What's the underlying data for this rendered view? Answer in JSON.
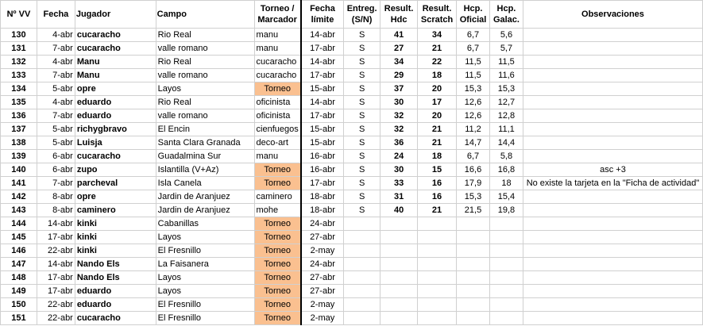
{
  "highlight_color": "#fac090",
  "headers": {
    "nvv": "Nº VV",
    "fecha": "Fecha",
    "jugador": "Jugador",
    "campo": "Campo",
    "torneo": "Torneo / Marcador",
    "limite": "Fecha límite",
    "entreg": "Entreg. (S/N)",
    "hdc": "Result. Hdc",
    "scratch": "Result. Scratch",
    "hcp_oficial": "Hcp. Oficial",
    "hcp_galac": "Hcp. Galac.",
    "observaciones": "Observaciones"
  },
  "rows": [
    {
      "n": "130",
      "fecha": "4-abr",
      "jugador": "cucaracho",
      "campo": "Rio Real",
      "marcador": "manu",
      "torneo": false,
      "limite": "14-abr",
      "entreg": "S",
      "hdc": "41",
      "scratch": "34",
      "oficial": "6,7",
      "galac": "5,6",
      "obs": ""
    },
    {
      "n": "131",
      "fecha": "7-abr",
      "jugador": "cucaracho",
      "campo": "valle romano",
      "marcador": "manu",
      "torneo": false,
      "limite": "17-abr",
      "entreg": "S",
      "hdc": "27",
      "scratch": "21",
      "oficial": "6,7",
      "galac": "5,7",
      "obs": ""
    },
    {
      "n": "132",
      "fecha": "4-abr",
      "jugador": "Manu",
      "campo": "Rio Real",
      "marcador": "cucaracho",
      "torneo": false,
      "limite": "14-abr",
      "entreg": "S",
      "hdc": "34",
      "scratch": "22",
      "oficial": "11,5",
      "galac": "11,5",
      "obs": ""
    },
    {
      "n": "133",
      "fecha": "7-abr",
      "jugador": "Manu",
      "campo": "valle romano",
      "marcador": "cucaracho",
      "torneo": false,
      "limite": "17-abr",
      "entreg": "S",
      "hdc": "29",
      "scratch": "18",
      "oficial": "11,5",
      "galac": "11,6",
      "obs": ""
    },
    {
      "n": "134",
      "fecha": "5-abr",
      "jugador": "opre",
      "campo": "Layos",
      "marcador": "Torneo",
      "torneo": true,
      "limite": "15-abr",
      "entreg": "S",
      "hdc": "37",
      "scratch": "20",
      "oficial": "15,3",
      "galac": "15,3",
      "obs": ""
    },
    {
      "n": "135",
      "fecha": "4-abr",
      "jugador": "eduardo",
      "campo": "Rio Real",
      "marcador": "oficinista",
      "torneo": false,
      "limite": "14-abr",
      "entreg": "S",
      "hdc": "30",
      "scratch": "17",
      "oficial": "12,6",
      "galac": "12,7",
      "obs": ""
    },
    {
      "n": "136",
      "fecha": "7-abr",
      "jugador": "eduardo",
      "campo": "valle romano",
      "marcador": "oficinista",
      "torneo": false,
      "limite": "17-abr",
      "entreg": "S",
      "hdc": "32",
      "scratch": "20",
      "oficial": "12,6",
      "galac": "12,8",
      "obs": ""
    },
    {
      "n": "137",
      "fecha": "5-abr",
      "jugador": "richygbravo",
      "campo": "El Encin",
      "marcador": "cienfuegos",
      "torneo": false,
      "limite": "15-abr",
      "entreg": "S",
      "hdc": "32",
      "scratch": "21",
      "oficial": "11,2",
      "galac": "11,1",
      "obs": ""
    },
    {
      "n": "138",
      "fecha": "5-abr",
      "jugador": "Luisja",
      "campo": "Santa Clara Granada",
      "marcador": "deco-art",
      "torneo": false,
      "limite": "15-abr",
      "entreg": "S",
      "hdc": "36",
      "scratch": "21",
      "oficial": "14,7",
      "galac": "14,4",
      "obs": ""
    },
    {
      "n": "139",
      "fecha": "6-abr",
      "jugador": "cucaracho",
      "campo": "Guadalmina Sur",
      "marcador": "manu",
      "torneo": false,
      "limite": "16-abr",
      "entreg": "S",
      "hdc": "24",
      "scratch": "18",
      "oficial": "6,7",
      "galac": "5,8",
      "obs": ""
    },
    {
      "n": "140",
      "fecha": "6-abr",
      "jugador": "zupo",
      "campo": "Islantilla (V+Az)",
      "marcador": "Torneo",
      "torneo": true,
      "limite": "16-abr",
      "entreg": "S",
      "hdc": "30",
      "scratch": "15",
      "oficial": "16,6",
      "galac": "16,8",
      "obs": "asc +3"
    },
    {
      "n": "141",
      "fecha": "7-abr",
      "jugador": "parcheval",
      "campo": "Isla Canela",
      "marcador": "Torneo",
      "torneo": true,
      "limite": "17-abr",
      "entreg": "S",
      "hdc": "33",
      "scratch": "16",
      "oficial": "17,9",
      "galac": "18",
      "obs": "No existe la tarjeta en la \"Ficha de actividad\""
    },
    {
      "n": "142",
      "fecha": "8-abr",
      "jugador": "opre",
      "campo": "Jardin de Aranjuez",
      "marcador": "caminero",
      "torneo": false,
      "limite": "18-abr",
      "entreg": "S",
      "hdc": "31",
      "scratch": "16",
      "oficial": "15,3",
      "galac": "15,4",
      "obs": ""
    },
    {
      "n": "143",
      "fecha": "8-abr",
      "jugador": "caminero",
      "campo": "Jardin de Aranjuez",
      "marcador": "mohe",
      "torneo": false,
      "limite": "18-abr",
      "entreg": "S",
      "hdc": "40",
      "scratch": "21",
      "oficial": "21,5",
      "galac": "19,8",
      "obs": ""
    },
    {
      "n": "144",
      "fecha": "14-abr",
      "jugador": "kinki",
      "campo": "Cabanillas",
      "marcador": "Torneo",
      "torneo": true,
      "limite": "24-abr",
      "entreg": "",
      "hdc": "",
      "scratch": "",
      "oficial": "",
      "galac": "",
      "obs": ""
    },
    {
      "n": "145",
      "fecha": "17-abr",
      "jugador": "kinki",
      "campo": "Layos",
      "marcador": "Torneo",
      "torneo": true,
      "limite": "27-abr",
      "entreg": "",
      "hdc": "",
      "scratch": "",
      "oficial": "",
      "galac": "",
      "obs": ""
    },
    {
      "n": "146",
      "fecha": "22-abr",
      "jugador": "kinki",
      "campo": "El Fresnillo",
      "marcador": "Torneo",
      "torneo": true,
      "limite": "2-may",
      "entreg": "",
      "hdc": "",
      "scratch": "",
      "oficial": "",
      "galac": "",
      "obs": ""
    },
    {
      "n": "147",
      "fecha": "14-abr",
      "jugador": "Nando Els",
      "campo": "La Faisanera",
      "marcador": "Torneo",
      "torneo": true,
      "limite": "24-abr",
      "entreg": "",
      "hdc": "",
      "scratch": "",
      "oficial": "",
      "galac": "",
      "obs": ""
    },
    {
      "n": "148",
      "fecha": "17-abr",
      "jugador": "Nando Els",
      "campo": "Layos",
      "marcador": "Torneo",
      "torneo": true,
      "limite": "27-abr",
      "entreg": "",
      "hdc": "",
      "scratch": "",
      "oficial": "",
      "galac": "",
      "obs": ""
    },
    {
      "n": "149",
      "fecha": "17-abr",
      "jugador": "eduardo",
      "campo": "Layos",
      "marcador": "Torneo",
      "torneo": true,
      "limite": "27-abr",
      "entreg": "",
      "hdc": "",
      "scratch": "",
      "oficial": "",
      "galac": "",
      "obs": ""
    },
    {
      "n": "150",
      "fecha": "22-abr",
      "jugador": "eduardo",
      "campo": "El Fresnillo",
      "marcador": "Torneo",
      "torneo": true,
      "limite": "2-may",
      "entreg": "",
      "hdc": "",
      "scratch": "",
      "oficial": "",
      "galac": "",
      "obs": ""
    },
    {
      "n": "151",
      "fecha": "22-abr",
      "jugador": "cucaracho",
      "campo": "El Fresnillo",
      "marcador": "Torneo",
      "torneo": true,
      "limite": "2-may",
      "entreg": "",
      "hdc": "",
      "scratch": "",
      "oficial": "",
      "galac": "",
      "obs": ""
    }
  ]
}
